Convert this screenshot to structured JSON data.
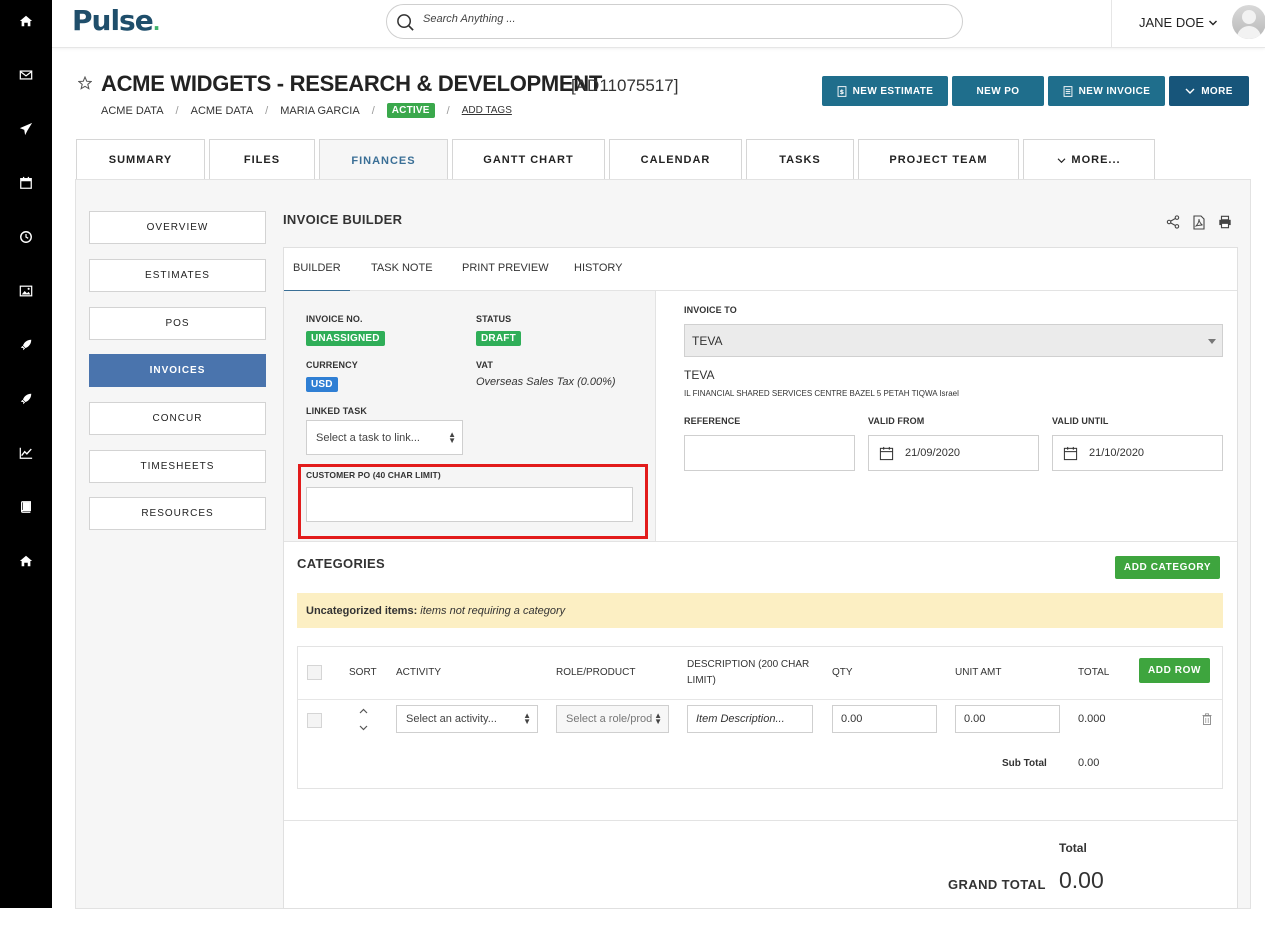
{
  "app": {
    "logo_text": "Pulse",
    "logo_dot": "."
  },
  "search": {
    "placeholder": "Search Anything ..."
  },
  "user": {
    "name": "JANE DOE"
  },
  "rail": [
    "home-icon",
    "mail-icon",
    "send-icon",
    "calendar-icon",
    "clock-icon",
    "image-icon",
    "rocket-icon",
    "rocket-icon",
    "chart-line-icon",
    "book-icon",
    "home-icon"
  ],
  "project": {
    "title": "ACME WIDGETS - RESEARCH & DEVELOPMENT",
    "code": "[AD11075517]",
    "breadcrumbs": [
      "ACME DATA",
      "ACME DATA",
      "MARIA GARCIA"
    ],
    "status": "ACTIVE",
    "add_tags": "ADD TAGS"
  },
  "actions": {
    "new_estimate": "NEW ESTIMATE",
    "new_po": "NEW PO",
    "new_invoice": "NEW INVOICE",
    "more": "MORE"
  },
  "tabs": [
    "SUMMARY",
    "FILES",
    "FINANCES",
    "GANTT CHART",
    "CALENDAR",
    "TASKS",
    "PROJECT TEAM",
    "MORE..."
  ],
  "side_menu": [
    "OVERVIEW",
    "ESTIMATES",
    "POS",
    "INVOICES",
    "CONCUR",
    "TIMESHEETS",
    "RESOURCES"
  ],
  "builder": {
    "title": "INVOICE BUILDER",
    "subtabs": [
      "BUILDER",
      "TASK NOTE",
      "PRINT PREVIEW",
      "HISTORY"
    ],
    "invoice_no_label": "INVOICE NO.",
    "invoice_no": "UNASSIGNED",
    "status_label": "STATUS",
    "status": "DRAFT",
    "currency_label": "CURRENCY",
    "currency": "USD",
    "vat_label": "VAT",
    "vat": "Overseas Sales Tax (0.00%)",
    "linked_task_label": "LINKED TASK",
    "linked_task_placeholder": "Select a task to link...",
    "customer_po_label": "CUSTOMER PO (40 CHAR LIMIT)",
    "customer_po_value": "",
    "invoice_to_label": "INVOICE TO",
    "invoice_to": "TEVA",
    "client_name": "TEVA",
    "client_address": "IL FINANCIAL SHARED SERVICES CENTRE BAZEL 5 PETAH TIQWA Israel",
    "reference_label": "REFERENCE",
    "reference_value": "",
    "valid_from_label": "VALID FROM",
    "valid_from": "21/09/2020",
    "valid_until_label": "VALID UNTIL",
    "valid_until": "21/10/2020"
  },
  "categories": {
    "title": "CATEGORIES",
    "add_category": "ADD CATEGORY",
    "uncat_bold": "Uncategorized items:",
    "uncat_text": "items not requiring a category",
    "columns": [
      "SORT",
      "ACTIVITY",
      "ROLE/PRODUCT",
      "DESCRIPTION (200 CHAR LIMIT)",
      "QTY",
      "UNIT AMT",
      "TOTAL"
    ],
    "add_row": "ADD ROW",
    "row": {
      "activity_placeholder": "Select an activity...",
      "role_placeholder": "Select a role/prod",
      "description_placeholder": "Item Description...",
      "qty": "0.00",
      "unit_amt": "0.00",
      "total": "0.000"
    },
    "subtotal_label": "Sub Total",
    "subtotal": "0.00"
  },
  "grand": {
    "total_label": "Total",
    "grand_total_label": "GRAND TOTAL",
    "grand_total": "0.00"
  }
}
